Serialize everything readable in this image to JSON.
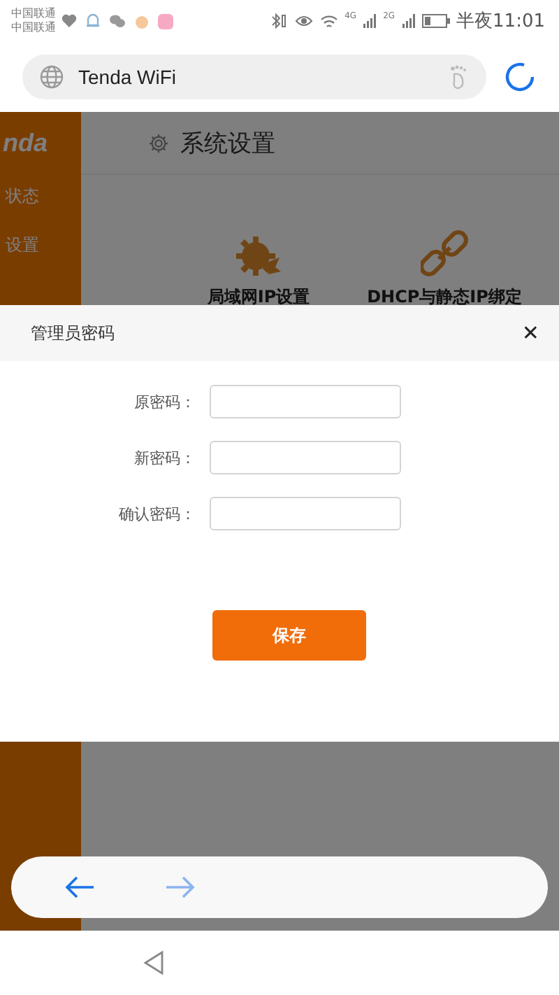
{
  "status_bar": {
    "carriers": [
      "中国联通",
      "中国联通"
    ],
    "network_labels": [
      "4G",
      "2G"
    ],
    "time": "半夜11:01"
  },
  "address_bar": {
    "title": "Tenda WiFi"
  },
  "page": {
    "logo": "nda",
    "sidebar": {
      "items": [
        {
          "label": "状态"
        },
        {
          "label": "设置"
        }
      ]
    },
    "header": {
      "title": "系统设置"
    },
    "cards": [
      {
        "kind": "ip",
        "label": "局域网IP设置"
      },
      {
        "kind": "link",
        "label": "DHCP与静态IP绑定"
      }
    ]
  },
  "dialog": {
    "title": "管理员密码",
    "close": "✕",
    "fields": [
      {
        "label": "原密码："
      },
      {
        "label": "新密码："
      },
      {
        "label": "确认密码："
      }
    ],
    "save_button": "保存"
  }
}
